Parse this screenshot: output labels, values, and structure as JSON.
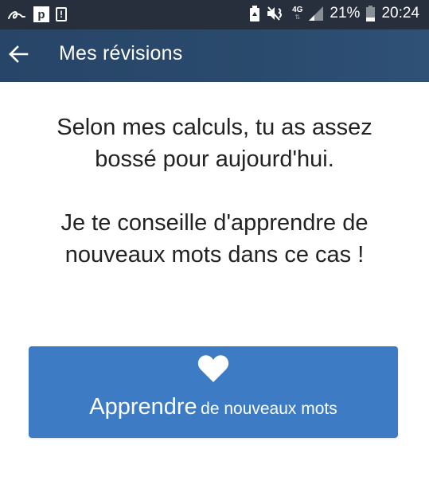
{
  "statusbar": {
    "left_icons": [
      "app-a-icon",
      "p-app-icon",
      "notice-icon"
    ],
    "right_icons": [
      "battery-saver-icon",
      "mute-icon",
      "4g-icon",
      "signal-icon",
      "battery-icon"
    ],
    "network_label": "4G",
    "battery_percent": "21%",
    "time": "20:24",
    "p_icon_letter": "p",
    "notice_icon_glyph": "!"
  },
  "toolbar": {
    "back_icon": "arrow-left-icon",
    "title": "Mes révisions"
  },
  "message": {
    "line1": "Selon mes calculs, tu as assez bossé pour aujourd'hui.",
    "line2": "Je te conseille d'apprendre de nouveaux mots dans ce cas !"
  },
  "learn_button": {
    "icon": "heart-icon",
    "label_main": "Apprendre",
    "label_sub": "de nouveaux mots"
  },
  "colors": {
    "statusbar": "#282f3c",
    "toolbar": "#2a4a6d",
    "button": "#3d7bc4",
    "text": "#222222"
  }
}
